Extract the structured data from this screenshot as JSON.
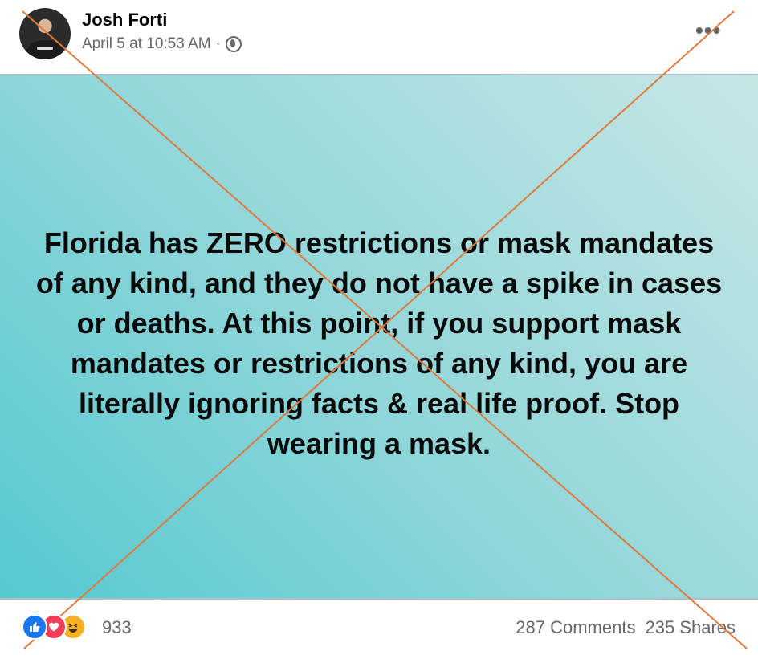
{
  "post": {
    "author": "Josh Forti",
    "timestamp": "April 5 at 10:53 AM",
    "separator": "·",
    "more_icon": "•••",
    "image_text": "Florida has ZERO restrictions or mask mandates of any kind, and they do not have a spike in cases or deaths. At this point, if you support mask mandates or restrictions of any kind, you are literally ignoring facts & real life proof. Stop wearing a mask."
  },
  "footer": {
    "reaction_icons": [
      "like-icon",
      "love-icon",
      "haha-icon"
    ],
    "reaction_count": "933",
    "comments": "287 Comments",
    "shares": "235 Shares"
  },
  "colors": {
    "cross_line": "#e07a3c",
    "gradient_start": "#54c9d0",
    "gradient_end": "#c7e6e6"
  }
}
